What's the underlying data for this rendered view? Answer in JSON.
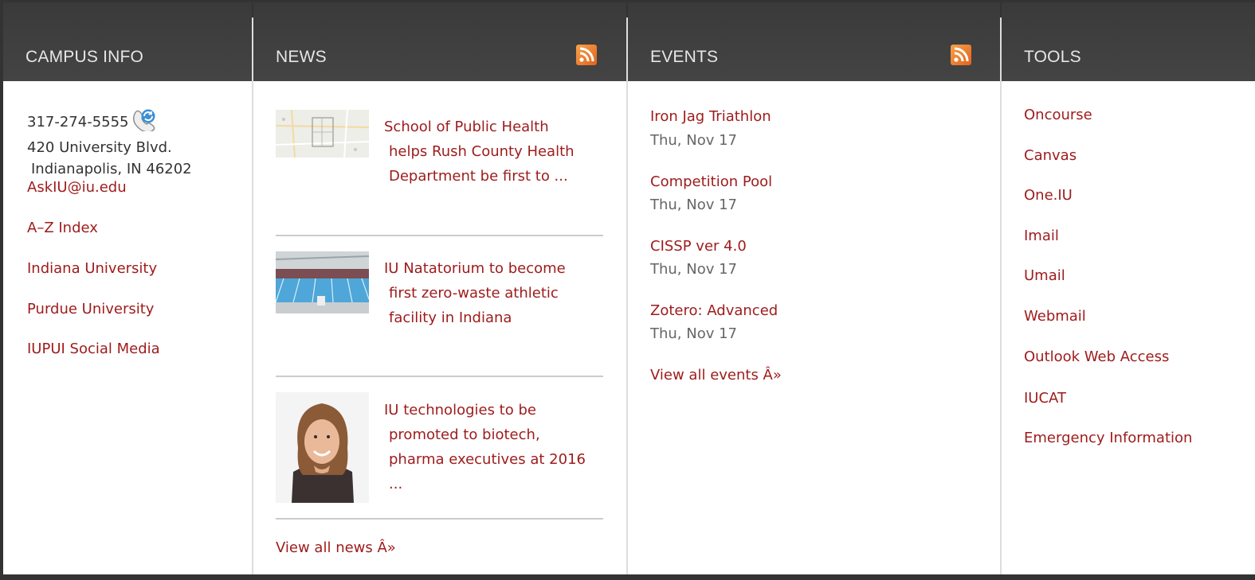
{
  "columns": {
    "campus": {
      "heading": "CAMPUS INFO"
    },
    "news": {
      "heading": "NEWS"
    },
    "events": {
      "heading": "EVENTS"
    },
    "tools": {
      "heading": "TOOLS"
    }
  },
  "campus": {
    "phone": "317-274-5555",
    "address_line1": "420 University Blvd.",
    "address_line2": "Indianapolis, IN 46202",
    "email": "AskIU@iu.edu",
    "links": [
      "A–Z Index",
      "Indiana University",
      "Purdue University",
      "IUPUI Social Media"
    ]
  },
  "news": {
    "items": [
      {
        "title_lines": [
          "School of Public Health",
          "helps Rush County Health",
          "Department be first to ..."
        ]
      },
      {
        "title_lines": [
          "IU Natatorium to become",
          "first zero-waste athletic",
          "facility in Indiana"
        ]
      },
      {
        "title_lines": [
          "IU technologies to be",
          "promoted to biotech,",
          "pharma executives at 2016",
          "..."
        ]
      }
    ],
    "view_all": "View all news Â»"
  },
  "events": {
    "items": [
      {
        "title": "Iron Jag Triathlon",
        "date": "Thu, Nov 17"
      },
      {
        "title": "Competition Pool",
        "date": "Thu, Nov 17"
      },
      {
        "title": "CISSP ver 4.0",
        "date": "Thu, Nov 17"
      },
      {
        "title": "Zotero: Advanced",
        "date": "Thu, Nov 17"
      }
    ],
    "view_all": "View all events Â»"
  },
  "tools": {
    "links": [
      "Oncourse",
      "Canvas",
      "One.IU",
      "Imail",
      "Umail",
      "Webmail",
      "Outlook Web Access",
      "IUCAT",
      "Emergency Information"
    ]
  },
  "colors": {
    "link": "#9e1b1b",
    "header_bg": "#3a3a3a",
    "rss": "#f08a2e"
  },
  "icons": {
    "rss": "rss-feed-icon",
    "phone": "skype-phone-icon"
  }
}
